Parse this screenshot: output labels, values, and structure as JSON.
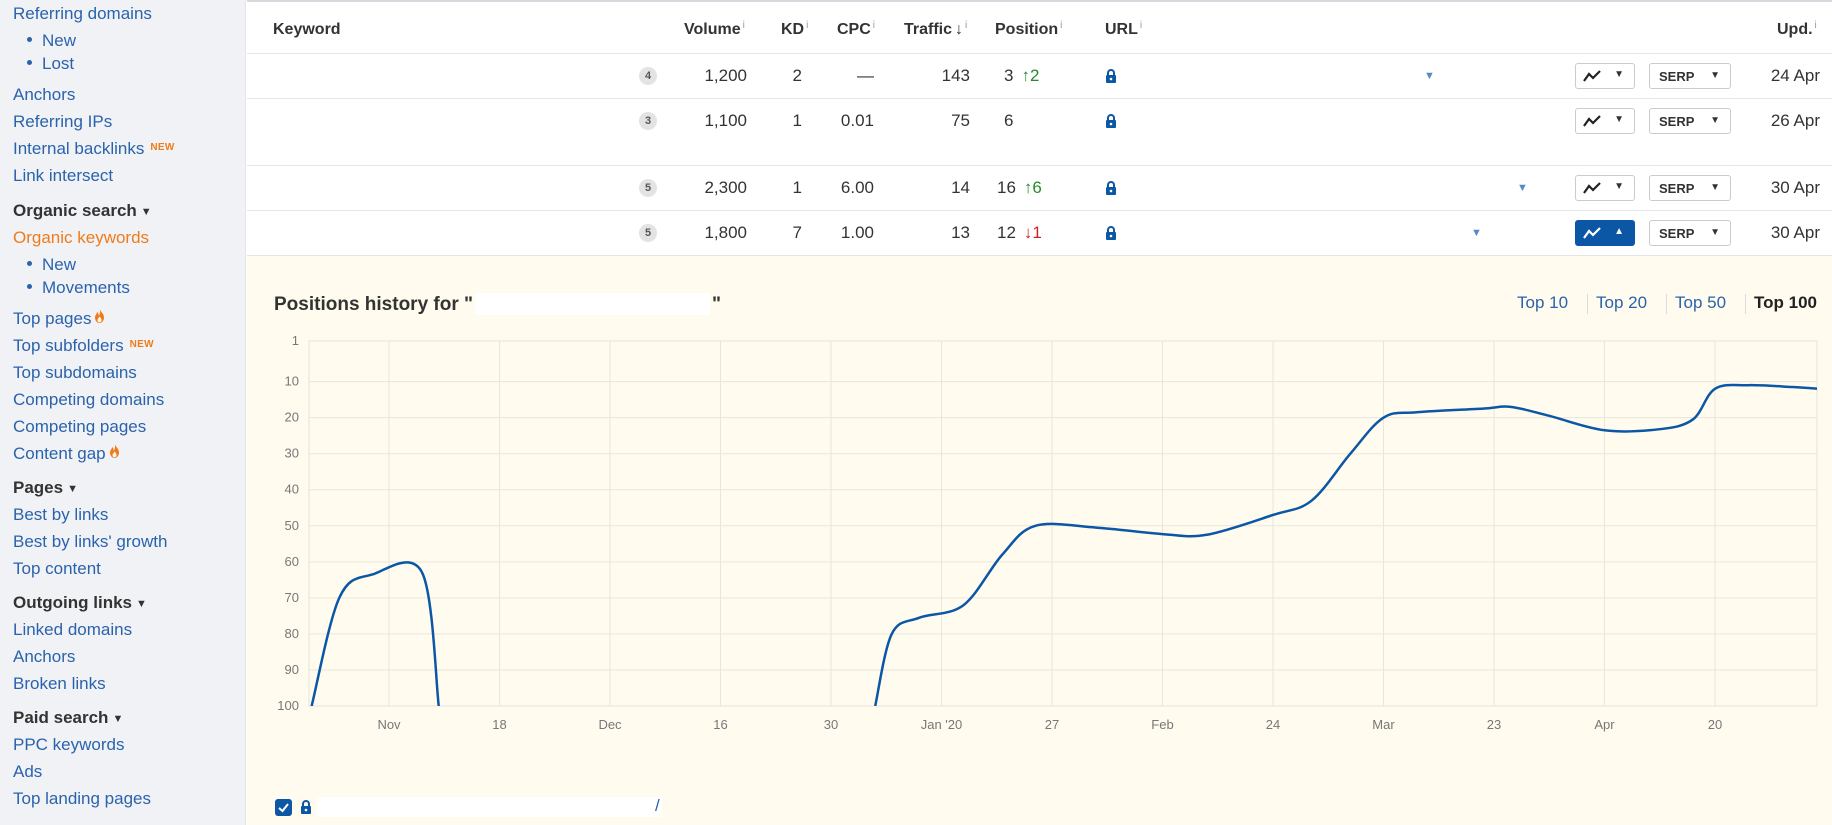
{
  "sidebar": {
    "referring_domains": "Referring domains",
    "rd_new": "New",
    "rd_lost": "Lost",
    "anchors": "Anchors",
    "referring_ips": "Referring IPs",
    "internal_backlinks": "Internal backlinks",
    "new_badge": "NEW",
    "link_intersect": "Link intersect",
    "organic_search": "Organic search",
    "organic_keywords": "Organic keywords",
    "ok_new": "New",
    "ok_movements": "Movements",
    "top_pages": "Top pages",
    "top_subfolders": "Top subfolders",
    "top_subdomains": "Top subdomains",
    "competing_domains": "Competing domains",
    "competing_pages": "Competing pages",
    "content_gap": "Content gap",
    "pages": "Pages",
    "best_by_links": "Best by links",
    "best_by_links_growth": "Best by links' growth",
    "top_content": "Top content",
    "outgoing_links": "Outgoing links",
    "linked_domains": "Linked domains",
    "anchors2": "Anchors",
    "broken_links": "Broken links",
    "paid_search": "Paid search",
    "ppc_keywords": "PPC keywords",
    "ads": "Ads",
    "top_landing_pages": "Top landing pages"
  },
  "table": {
    "headers": {
      "keyword": "Keyword",
      "volume": "Volume",
      "kd": "KD",
      "cpc": "CPC",
      "traffic": "Traffic",
      "position": "Position",
      "url": "URL",
      "upd": "Upd.",
      "info": "i"
    },
    "rows": [
      {
        "serp_features": "4",
        "volume": "1,200",
        "kd": "2",
        "cpc": "—",
        "traffic": "143",
        "position": "3",
        "change": "2",
        "dir": "up",
        "serp": "SERP",
        "updated": "24 Apr"
      },
      {
        "serp_features": "3",
        "volume": "1,100",
        "kd": "1",
        "cpc": "0.01",
        "traffic": "75",
        "position": "6",
        "change": "",
        "dir": "none",
        "serp": "SERP",
        "updated": "26 Apr"
      },
      {
        "serp_features": "5",
        "volume": "2,300",
        "kd": "1",
        "cpc": "6.00",
        "traffic": "14",
        "position": "16",
        "change": "6",
        "dir": "up",
        "serp": "SERP",
        "updated": "30 Apr"
      },
      {
        "serp_features": "5",
        "volume": "1,800",
        "kd": "7",
        "cpc": "1.00",
        "traffic": "13",
        "position": "12",
        "change": "1",
        "dir": "down",
        "serp": "SERP",
        "updated": "30 Apr"
      }
    ]
  },
  "panel": {
    "title_prefix": "Positions history for \"",
    "title_suffix": "\"",
    "tabs": [
      "Top 10",
      "Top 20",
      "Top 50",
      "Top 100"
    ],
    "selected_tab": "Top 100",
    "url_suffix": "/"
  },
  "chart_data": {
    "type": "line",
    "title": "",
    "xlabel": "",
    "ylabel": "",
    "y_inverted": true,
    "ylim": [
      1,
      100
    ],
    "y_ticks": [
      "1",
      "10",
      "20",
      "30",
      "40",
      "50",
      "60",
      "70",
      "80",
      "90",
      "100"
    ],
    "x_ticks": [
      "Nov",
      "18",
      "Dec",
      "16",
      "30",
      "Jan '20",
      "27",
      "Feb",
      "24",
      "Mar",
      "23",
      "Apr",
      "20"
    ],
    "grid": true,
    "series": [
      {
        "color": "#0b57a6",
        "segments": [
          [
            [
              -0.7,
              100
            ],
            [
              -0.45,
              70
            ],
            [
              -0.15,
              63.5
            ],
            [
              0.3,
              63
            ],
            [
              0.45,
              100
            ]
          ],
          [
            [
              4.4,
              100
            ],
            [
              4.55,
              80
            ],
            [
              4.8,
              75.5
            ],
            [
              5.2,
              72
            ],
            [
              5.55,
              58
            ],
            [
              5.85,
              50
            ],
            [
              6.4,
              50.5
            ],
            [
              7.0,
              52.3
            ],
            [
              7.4,
              52.5
            ],
            [
              8.0,
              47
            ],
            [
              8.35,
              43
            ],
            [
              8.7,
              30
            ],
            [
              9.0,
              20
            ],
            [
              9.3,
              18.5
            ],
            [
              9.9,
              17.5
            ],
            [
              10.15,
              17
            ],
            [
              10.5,
              19.5
            ],
            [
              11.0,
              23.5
            ],
            [
              11.5,
              23.2
            ],
            [
              11.8,
              20.5
            ],
            [
              12.0,
              12
            ],
            [
              12.3,
              11
            ],
            [
              12.7,
              11.5
            ],
            [
              12.95,
              12
            ]
          ]
        ]
      }
    ]
  }
}
